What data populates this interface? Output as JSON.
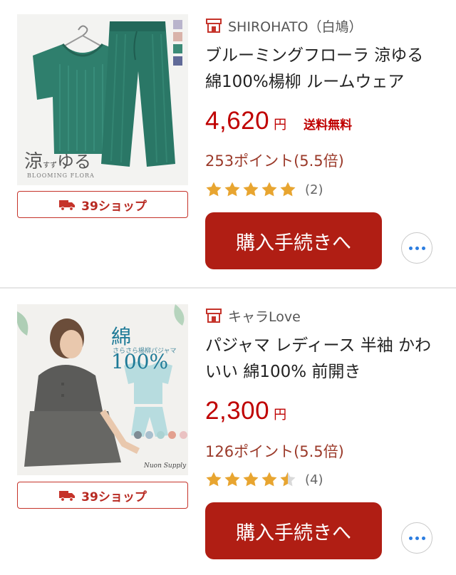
{
  "products": [
    {
      "shop_name": "SHIROHATO（白鳩）",
      "title": "ブルーミングフローラ 涼ゆる 綿100%楊柳 ルームウェア",
      "price": "4,620",
      "currency": "円",
      "shipping": "送料無料",
      "points": "253ポイント(5.5倍)",
      "rating": 5,
      "review_count": "(2)",
      "ship_badge": "39ショップ",
      "buy_label": "購入手続きへ",
      "image_text": {
        "brand": "涼",
        "brand_small": "すず",
        "brand_tail": "ゆる",
        "sub": "BLOOMING FLORA"
      }
    },
    {
      "shop_name": "キャラLove",
      "title": "パジャマ レディース 半袖 かわいい 綿100% 前開き",
      "price": "2,300",
      "currency": "円",
      "shipping": "",
      "points": "126ポイント(5.5倍)",
      "rating": 4.5,
      "review_count": "(4)",
      "ship_badge": "39ショップ",
      "buy_label": "購入手続きへ",
      "image_text": {
        "headline": "綿100%",
        "sub": "さらさら楊柳パジャマ",
        "signature": "Nuon Supply"
      }
    }
  ],
  "colors": {
    "price_red": "#bf0000",
    "buy_button": "#b01e14",
    "star": "#e8a530",
    "more_dots": "#2b7de0"
  },
  "icons": {
    "shop": "shop-icon",
    "truck": "truck-icon",
    "more": "more-icon",
    "star": "star-icon"
  }
}
